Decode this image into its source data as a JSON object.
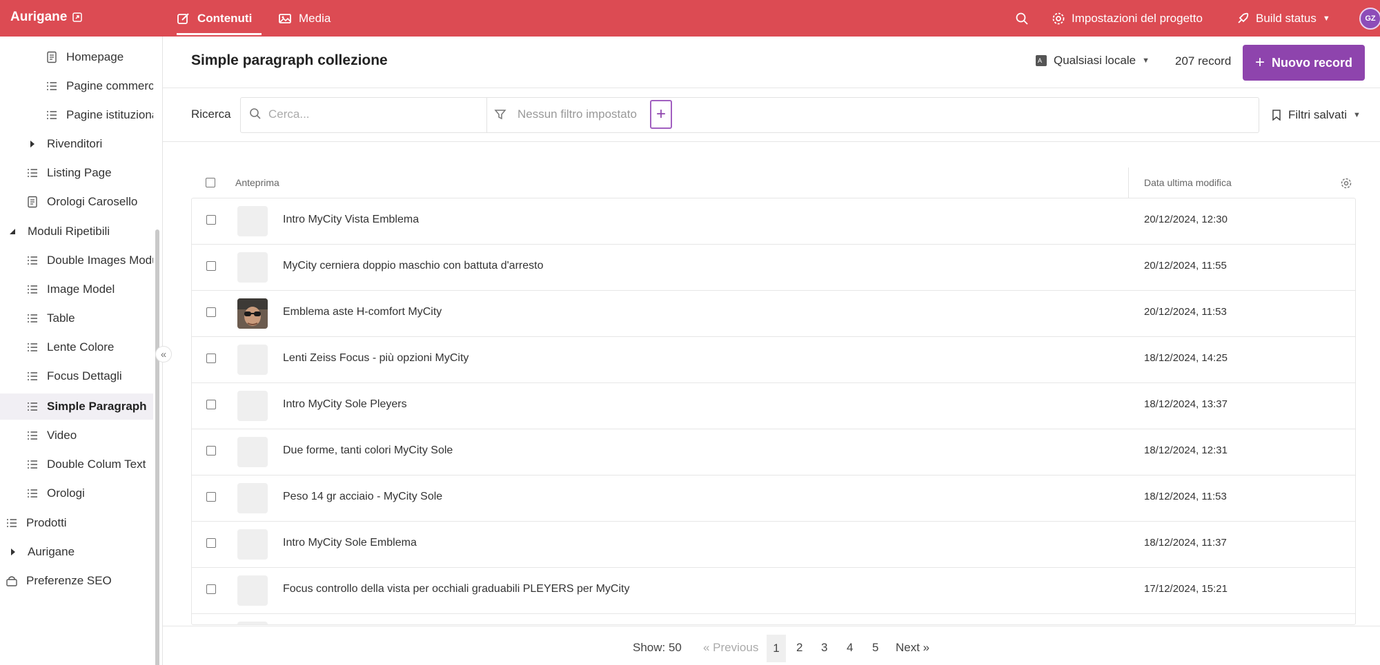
{
  "topbar": {
    "brand": "Aurigane",
    "tabs": [
      {
        "label": "Contenuti",
        "icon": "edit-icon",
        "active": true
      },
      {
        "label": "Media",
        "icon": "image-icon",
        "active": false
      }
    ],
    "settings_label": "Impostazioni del progetto",
    "build_label": "Build status",
    "avatar_initials": "GZ",
    "color": "#dc4b53"
  },
  "sidebar": {
    "items": [
      {
        "label": "Homepage",
        "icon": "page-icon"
      },
      {
        "label": "Pagine commerciali",
        "icon": "list-icon"
      },
      {
        "label": "Pagine istituzionali",
        "icon": "list-icon"
      },
      {
        "label": "Rivenditori",
        "icon": "caret-right-icon"
      },
      {
        "label": "Listing Page",
        "icon": "list-icon"
      },
      {
        "label": "Orologi Carosello",
        "icon": "page-icon"
      },
      {
        "label": "Moduli Ripetibili",
        "icon": "caret-down-icon"
      },
      {
        "label": "Double Images Module",
        "icon": "list-icon"
      },
      {
        "label": "Image Model",
        "icon": "list-icon"
      },
      {
        "label": "Table",
        "icon": "list-icon"
      },
      {
        "label": "Lente Colore",
        "icon": "list-icon"
      },
      {
        "label": "Focus Dettagli",
        "icon": "list-icon"
      },
      {
        "label": "Simple Paragraph",
        "icon": "list-icon",
        "active": true
      },
      {
        "label": "Video",
        "icon": "list-icon"
      },
      {
        "label": "Double Colum Text",
        "icon": "list-icon"
      },
      {
        "label": "Orologi",
        "icon": "list-icon"
      },
      {
        "label": "Prodotti",
        "icon": "list-icon"
      },
      {
        "label": "Aurigane",
        "icon": "caret-right-icon"
      },
      {
        "label": "Preferenze SEO",
        "icon": "seo-icon"
      }
    ],
    "collapse_glyph": "«"
  },
  "main": {
    "title": "Simple paragraph collezione",
    "locale": "Qualsiasi locale",
    "record_count": "207 record",
    "new_button": "Nuovo record",
    "accent": "#8e44ad"
  },
  "search": {
    "label": "Ricerca",
    "placeholder": "Cerca...",
    "filter_text": "Nessun filtro impostato",
    "add_filter": "+",
    "saved_filters": "Filtri salvati"
  },
  "table": {
    "columns": [
      "Anteprima",
      "Data ultima modifica"
    ],
    "rows": [
      {
        "title": "Intro MyCity Vista Emblema",
        "date": "20/12/2024, 12:30",
        "has_photo": false
      },
      {
        "title": "MyCity cerniera doppio maschio con battuta d'arresto",
        "date": "20/12/2024, 11:55",
        "has_photo": false
      },
      {
        "title": "Emblema aste H-comfort MyCity",
        "date": "20/12/2024, 11:53",
        "has_photo": true
      },
      {
        "title": "Lenti Zeiss Focus - più opzioni MyCity",
        "date": "18/12/2024, 14:25",
        "has_photo": false
      },
      {
        "title": "Intro MyCity Sole Pleyers",
        "date": "18/12/2024, 13:37",
        "has_photo": false
      },
      {
        "title": "Due forme, tanti colori MyCity Sole",
        "date": "18/12/2024, 12:31",
        "has_photo": false
      },
      {
        "title": "Peso 14 gr acciaio - MyCity Sole",
        "date": "18/12/2024, 11:53",
        "has_photo": false
      },
      {
        "title": "Intro MyCity Sole Emblema",
        "date": "18/12/2024, 11:37",
        "has_photo": false
      },
      {
        "title": "Focus controllo della vista per occhiali graduabili PLEYERS per MyCity",
        "date": "17/12/2024, 15:21",
        "has_photo": false
      }
    ]
  },
  "pagination": {
    "show": "Show: 50",
    "previous": "« Previous",
    "pages": [
      "1",
      "2",
      "3",
      "4",
      "5"
    ],
    "current": "1",
    "next": "Next »"
  }
}
